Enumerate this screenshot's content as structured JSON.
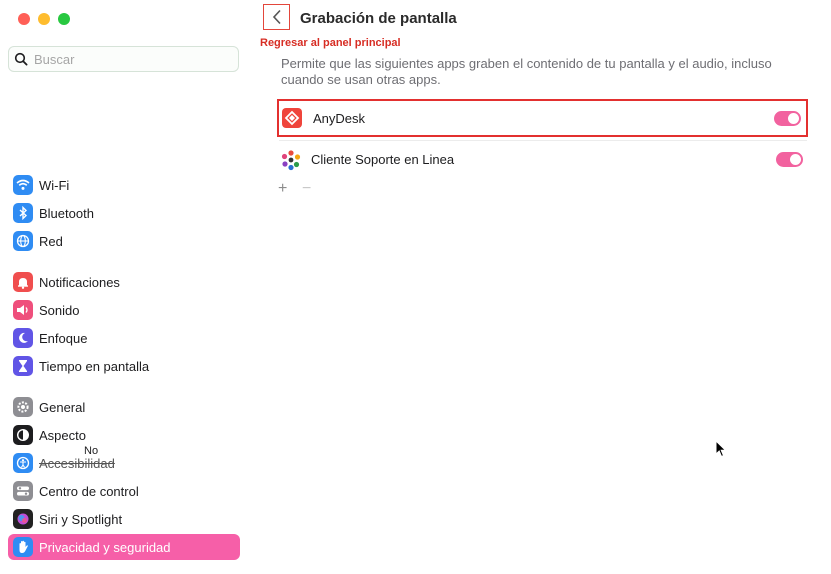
{
  "search": {
    "placeholder": "Buscar"
  },
  "sidebar": {
    "group1": [
      {
        "label": "Wi-Fi",
        "icon": "wifi-icon",
        "color": "#2f8cf3"
      },
      {
        "label": "Bluetooth",
        "icon": "bluetooth-icon",
        "color": "#2f8cf3"
      },
      {
        "label": "Red",
        "icon": "globe-icon",
        "color": "#2f8cf3"
      }
    ],
    "group2": [
      {
        "label": "Notificaciones",
        "icon": "bell-icon",
        "color": "#f04e4e"
      },
      {
        "label": "Sonido",
        "icon": "speaker-icon",
        "color": "#ef4f7c"
      },
      {
        "label": "Enfoque",
        "icon": "moon-icon",
        "color": "#6155e6"
      },
      {
        "label": "Tiempo en pantalla",
        "icon": "hourglass-icon",
        "color": "#6155e6"
      }
    ],
    "group3": [
      {
        "label": "General",
        "icon": "gear-icon",
        "color": "#8e8e93"
      },
      {
        "label": "Aspecto",
        "icon": "appearance-icon",
        "color": "#1d1d1f"
      },
      {
        "label": "Accesibilidad",
        "icon": "accessibility-icon",
        "color": "#2f8cf3"
      },
      {
        "label": "Centro de control",
        "icon": "control-center-icon",
        "color": "#8e8e93"
      },
      {
        "label": "Siri y Spotlight",
        "icon": "siri-icon",
        "color": "#222222"
      },
      {
        "label": "Privacidad y seguridad",
        "icon": "hand-icon",
        "color": "#2f8cf3"
      }
    ],
    "overlay_text": "No"
  },
  "main": {
    "title": "Grabación de pantalla",
    "annotation": "Regresar al panel principal",
    "description": "Permite que las siguientes apps graben el contenido de tu pantalla y el audio, incluso cuando se usan otras apps.",
    "apps": [
      {
        "name": "AnyDesk",
        "enabled": true
      },
      {
        "name": "Cliente Soporte en Linea",
        "enabled": true
      }
    ],
    "add_label": "+",
    "remove_label": "−"
  },
  "colors": {
    "accent": "#f65fa8",
    "toggle_on": "#f2629f",
    "highlight": "#e3302f"
  }
}
